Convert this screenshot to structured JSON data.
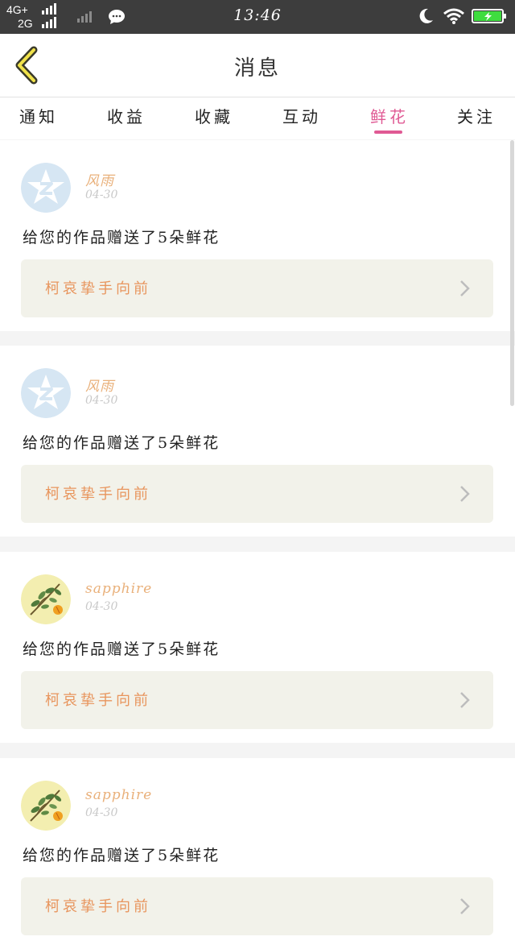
{
  "status_bar": {
    "network_top": "4G+",
    "network_bottom": "2G",
    "time": "13:46",
    "icons": [
      "signal-icon",
      "signal-weak-icon",
      "chat-bubble-icon",
      "moon-icon",
      "wifi-icon",
      "battery-charging-icon"
    ]
  },
  "header": {
    "title": "消息",
    "back_icon": "chevron-left-icon"
  },
  "tabs": {
    "items": [
      "通知",
      "收益",
      "收藏",
      "互动",
      "鲜花",
      "关注"
    ],
    "active": "鲜花",
    "accent_color": "#e05a94"
  },
  "messages": [
    {
      "avatar": "qq-star-icon",
      "username": "风雨",
      "date": "04-30",
      "text": "给您的作品赠送了5朵鲜花",
      "work_title": "柯哀挚手向前"
    },
    {
      "avatar": "qq-star-icon",
      "username": "风雨",
      "date": "04-30",
      "text": "给您的作品赠送了5朵鲜花",
      "work_title": "柯哀挚手向前"
    },
    {
      "avatar": "plant-illustration",
      "username": "sapphire",
      "date": "04-30",
      "text": "给您的作品赠送了5朵鲜花",
      "work_title": "柯哀挚手向前"
    },
    {
      "avatar": "plant-illustration",
      "username": "sapphire",
      "date": "04-30",
      "text": "给您的作品赠送了5朵鲜花",
      "work_title": "柯哀挚手向前"
    }
  ],
  "colors": {
    "username": "#e9b07a",
    "work_title": "#e8955d",
    "work_bg": "#f2f2ea"
  }
}
